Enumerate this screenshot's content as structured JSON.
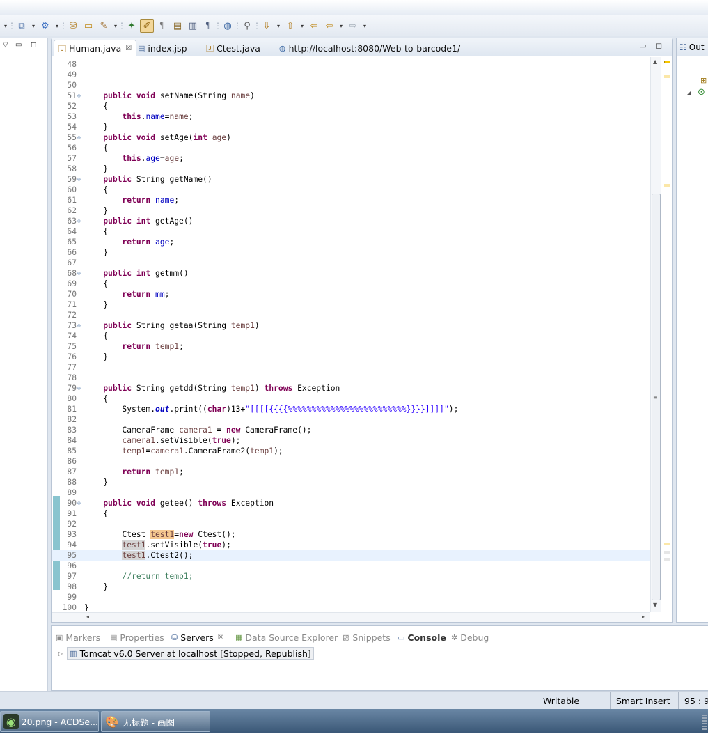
{
  "toolbar": {
    "buttons": [
      "new-wizard",
      "dropdown",
      "run",
      "dropdown",
      "open-type",
      "open-resource",
      "deploy",
      "dropdown",
      "toggle-breakpoint",
      "mark-occurrences",
      "show-whitespace",
      "open-task",
      "show-annotations",
      "show-block",
      "globe",
      "search",
      "next-annotation",
      "dropdown",
      "prev-annotation",
      "dropdown",
      "last-edit",
      "back",
      "dropdown",
      "forward",
      "dropdown"
    ]
  },
  "editor": {
    "tabs": [
      {
        "label": "Human.java",
        "icon": "java-file-icon",
        "active": true,
        "close": "☒"
      },
      {
        "label": "index.jsp",
        "icon": "jsp-file-icon",
        "active": false
      },
      {
        "label": "Ctest.java",
        "icon": "java-file-icon",
        "active": false
      },
      {
        "label": "http://localhost:8080/Web-to-barcode1/",
        "icon": "globe-icon",
        "active": false
      }
    ],
    "current_line": 95,
    "lines": [
      {
        "n": "48",
        "fold": "",
        "code": ""
      },
      {
        "n": "49",
        "fold": "",
        "code": ""
      },
      {
        "n": "50",
        "fold": "",
        "code": ""
      },
      {
        "n": "51",
        "fold": "⊖",
        "code": "    <span class=\"kw\">public</span> <span class=\"kw\">void</span> setName(String <span class=\"prm\">name</span>)"
      },
      {
        "n": "52",
        "fold": "",
        "code": "    {"
      },
      {
        "n": "53",
        "fold": "",
        "code": "        <span class=\"kw\">this</span>.<span class=\"fld\">name</span>=<span class=\"prm\">name</span>;"
      },
      {
        "n": "54",
        "fold": "",
        "code": "    }"
      },
      {
        "n": "55",
        "fold": "⊖",
        "code": "    <span class=\"kw\">public</span> <span class=\"kw\">void</span> setAge(<span class=\"kw\">int</span> <span class=\"prm\">age</span>)"
      },
      {
        "n": "56",
        "fold": "",
        "code": "    {"
      },
      {
        "n": "57",
        "fold": "",
        "code": "        <span class=\"kw\">this</span>.<span class=\"fld\">age</span>=<span class=\"prm\">age</span>;"
      },
      {
        "n": "58",
        "fold": "",
        "code": "    }"
      },
      {
        "n": "59",
        "fold": "⊖",
        "code": "    <span class=\"kw\">public</span> String getName()"
      },
      {
        "n": "60",
        "fold": "",
        "code": "    {"
      },
      {
        "n": "61",
        "fold": "",
        "code": "        <span class=\"kw\">return</span> <span class=\"fld\">name</span>;"
      },
      {
        "n": "62",
        "fold": "",
        "code": "    }"
      },
      {
        "n": "63",
        "fold": "⊖",
        "code": "    <span class=\"kw\">public</span> <span class=\"kw\">int</span> getAge()"
      },
      {
        "n": "64",
        "fold": "",
        "code": "    {"
      },
      {
        "n": "65",
        "fold": "",
        "code": "        <span class=\"kw\">return</span> <span class=\"fld\">age</span>;"
      },
      {
        "n": "66",
        "fold": "",
        "code": "    }"
      },
      {
        "n": "67",
        "fold": "",
        "code": ""
      },
      {
        "n": "68",
        "fold": "⊖",
        "code": "    <span class=\"kw\">public</span> <span class=\"kw\">int</span> getmm()"
      },
      {
        "n": "69",
        "fold": "",
        "code": "    {"
      },
      {
        "n": "70",
        "fold": "",
        "code": "        <span class=\"kw\">return</span> <span class=\"fld\">mm</span>;"
      },
      {
        "n": "71",
        "fold": "",
        "code": "    }"
      },
      {
        "n": "72",
        "fold": "",
        "code": ""
      },
      {
        "n": "73",
        "fold": "⊖",
        "code": "    <span class=\"kw\">public</span> String getaa(String <span class=\"prm\">temp1</span>)"
      },
      {
        "n": "74",
        "fold": "",
        "code": "    {"
      },
      {
        "n": "75",
        "fold": "",
        "code": "        <span class=\"kw\">return</span> <span class=\"prm\">temp1</span>;"
      },
      {
        "n": "76",
        "fold": "",
        "code": "    }"
      },
      {
        "n": "77",
        "fold": "",
        "code": ""
      },
      {
        "n": "78",
        "fold": "",
        "code": ""
      },
      {
        "n": "79",
        "fold": "⊖",
        "code": "    <span class=\"kw\">public</span> String getdd(String <span class=\"prm\">temp1</span>) <span class=\"kw\">throws</span> Exception"
      },
      {
        "n": "80",
        "fold": "",
        "code": "    {"
      },
      {
        "n": "81",
        "fold": "",
        "code": "        System.<span class=\"stat\">out</span>.print((<span class=\"kw\">char</span>)13+<span class=\"str\">\"[[[[{{{{%%%%%%%%%%%%%%%%%%%%%%%%%}}}}]]]]\"</span>);"
      },
      {
        "n": "82",
        "fold": "",
        "code": ""
      },
      {
        "n": "83",
        "fold": "",
        "code": "        CameraFrame <span class=\"prm\">camera1</span> = <span class=\"kw\">new</span> CameraFrame();"
      },
      {
        "n": "84",
        "fold": "",
        "code": "        <span class=\"prm\">camera1</span>.setVisible(<span class=\"kw\">true</span>);"
      },
      {
        "n": "85",
        "fold": "",
        "code": "        <span class=\"prm\">temp1</span>=<span class=\"prm\">camera1</span>.CameraFrame2(<span class=\"prm\">temp1</span>);"
      },
      {
        "n": "86",
        "fold": "",
        "code": ""
      },
      {
        "n": "87",
        "fold": "",
        "code": "        <span class=\"kw\">return</span> <span class=\"prm\">temp1</span>;"
      },
      {
        "n": "88",
        "fold": "",
        "code": "    }"
      },
      {
        "n": "89",
        "fold": "",
        "code": ""
      },
      {
        "n": "90",
        "fold": "⊖",
        "code": "    <span class=\"kw\">public</span> <span class=\"kw\">void</span> getee() <span class=\"kw\">throws</span> Exception"
      },
      {
        "n": "91",
        "fold": "",
        "code": "    {"
      },
      {
        "n": "92",
        "fold": "",
        "code": ""
      },
      {
        "n": "93",
        "fold": "",
        "code": "        Ctest <span class=\"prm occw\">test1</span>=<span class=\"kw\">new</span> Ctest();"
      },
      {
        "n": "94",
        "fold": "",
        "code": "        <span class=\"prm occ\">test1</span>.setVisible(<span class=\"kw\">true</span>);"
      },
      {
        "n": "95",
        "fold": "",
        "code": "        <span class=\"prm occ\">test1</span>.Ctest2();"
      },
      {
        "n": "96",
        "fold": "",
        "code": ""
      },
      {
        "n": "97",
        "fold": "",
        "code": "        <span class=\"cmt\">//return temp1;</span>"
      },
      {
        "n": "98",
        "fold": "",
        "code": "    }"
      },
      {
        "n": "99",
        "fold": "",
        "code": ""
      },
      {
        "n": "100",
        "fold": "",
        "code": "}"
      }
    ]
  },
  "outline": {
    "label": "Out"
  },
  "bottom_panel": {
    "tabs": [
      {
        "label": "Markers",
        "icon": "markers-icon"
      },
      {
        "label": "Properties",
        "icon": "properties-icon"
      },
      {
        "label": "Servers",
        "icon": "servers-icon",
        "active": true,
        "close": "☒"
      },
      {
        "label": "Data Source Explorer",
        "icon": "data-source-icon"
      },
      {
        "label": "Snippets",
        "icon": "snippets-icon"
      },
      {
        "label": "Console",
        "icon": "console-icon",
        "bold": true
      },
      {
        "label": "Debug",
        "icon": "debug-icon"
      }
    ],
    "server": "Tomcat v6.0 Server at localhost  [Stopped, Republish]"
  },
  "statusbar": {
    "writable": "Writable",
    "insert_mode": "Smart Insert",
    "position": "95 : 9"
  },
  "taskbar": {
    "items": [
      {
        "label": "20.png - ACDSe...",
        "icon": "acdsee-icon"
      },
      {
        "label": "无标题 - 画图",
        "icon": "paint-icon"
      }
    ]
  },
  "colors": {
    "keyword": "#7f0055",
    "field": "#0000c0",
    "string": "#2a00ff",
    "comment": "#3f7f5f",
    "current_line": "#e8f2fe"
  }
}
